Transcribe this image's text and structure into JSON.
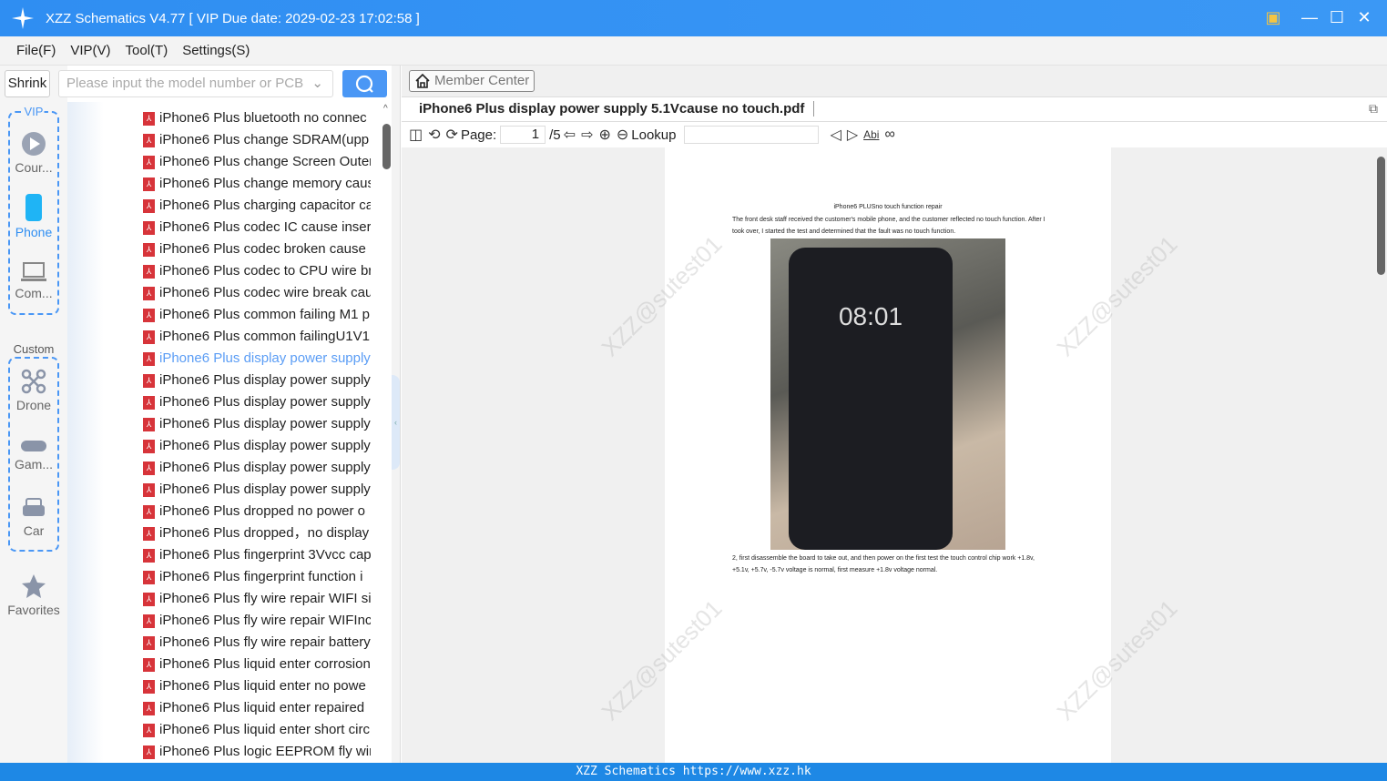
{
  "window": {
    "title": "XZZ Schematics V4.77 [ VIP Due date: 2029-02-23 17:02:58 ]"
  },
  "menu": [
    "File(F)",
    "VIP(V)",
    "Tool(T)",
    "Settings(S)"
  ],
  "search": {
    "shrink_label": "Shrink",
    "placeholder": "Please input the model number or PCB"
  },
  "nav": {
    "vip_label": "VIP",
    "custom_label": "Custom",
    "vip_items": [
      {
        "label": "Cour...",
        "icon": "play-icon"
      },
      {
        "label": "Phone",
        "icon": "phone-icon"
      },
      {
        "label": "Com...",
        "icon": "laptop-icon"
      }
    ],
    "custom_items": [
      {
        "label": "Drone",
        "icon": "drone-icon"
      },
      {
        "label": "Gam...",
        "icon": "gamepad-icon"
      },
      {
        "label": "Car",
        "icon": "car-icon"
      }
    ],
    "favorites": "Favorites"
  },
  "files": [
    "iPhone6 Plus bluetooth no connec",
    "iPhone6 Plus change SDRAM(upp",
    "iPhone6 Plus change Screen Outer",
    "iPhone6 Plus change memory caus",
    "iPhone6 Plus charging capacitor ca",
    "iPhone6 Plus codec IC cause insert",
    "iPhone6 Plus codec broken cause",
    "iPhone6 Plus codec to CPU wire br",
    "iPhone6 Plus codec wire break  cau",
    "iPhone6 Plus common failing M1 p",
    "iPhone6 Plus common failingU1V1",
    "iPhone6 Plus display power supply",
    "iPhone6 Plus display power supply",
    "iPhone6 Plus display power supply",
    "iPhone6 Plus display power supply",
    "iPhone6 Plus display power supply",
    "iPhone6 Plus display power supply",
    "iPhone6 Plus display power supply",
    "iPhone6 Plus dropped no power o",
    "iPhone6 Plus dropped，no display",
    "iPhone6 Plus fingerprint 3Vvcc cap",
    "iPhone6 Plus fingerprint function i",
    "iPhone6 Plus fly wire repair WIFI si",
    "iPhone6 Plus fly wire repair WIFInc",
    "iPhone6 Plus fly wire repair battery",
    "iPhone6 Plus liquid enter corrosion",
    "iPhone6 Plus liquid enter no powe",
    "iPhone6 Plus liquid enter repaired",
    "iPhone6 Plus liquid enter short circ",
    "iPhone6 Plus logic EEPROM fly wir"
  ],
  "active_file_index": 11,
  "viewer": {
    "member_center": "Member Center",
    "tab": "iPhone6 Plus display power supply 5.1Vcause no touch.pdf",
    "page_label": "Page:",
    "page": "1",
    "page_total": "/5",
    "lookup_label": "Lookup",
    "abi": "Abi"
  },
  "doc": {
    "heading": "iPhone6 PLUSno touch function repair",
    "p1": "The front desk staff received the customer's mobile phone, and the customer reflected no touch function. After I took over, I started the test and determined that the fault was no touch function.",
    "phone_time": "08:01",
    "p2": "2, first disassemble the board to take out, and then power on the first test the touch control chip work +1.8v, +5.1v, +5.7v, -5.7v voltage is normal, first measure +1.8v voltage normal.",
    "watermark": "XZZ@sutest01"
  },
  "status": "XZZ Schematics https://www.xzz.hk",
  "colors": {
    "accent": "#2f8ef2",
    "pdf": "#d7343a",
    "active": "#5b9df5"
  }
}
